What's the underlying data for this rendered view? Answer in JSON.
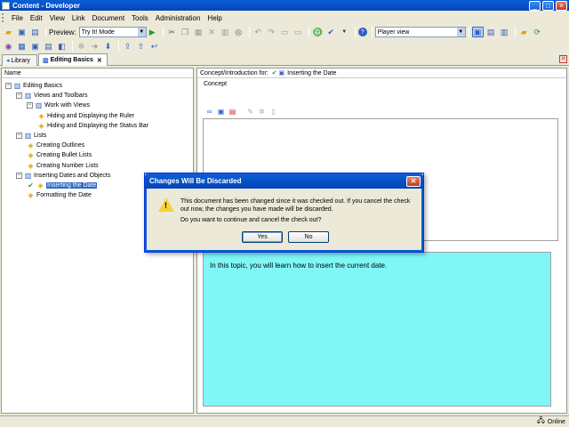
{
  "window": {
    "title": "Content - Developer"
  },
  "menu": [
    "File",
    "Edit",
    "View",
    "Link",
    "Document",
    "Tools",
    "Administration",
    "Help"
  ],
  "toolbar": {
    "preview_label": "Preview:",
    "preview_mode": "Try It! Mode",
    "view_mode": "Player view"
  },
  "tabs": [
    {
      "label": "Library",
      "active": false
    },
    {
      "label": "Editing Basics",
      "active": true
    }
  ],
  "tree": {
    "header": "Name",
    "items": [
      {
        "label": "Editing Basics",
        "level": 0,
        "type": "book",
        "expanded": true
      },
      {
        "label": "Views and Toolbars",
        "level": 1,
        "type": "book",
        "expanded": true
      },
      {
        "label": "Work with Views",
        "level": 2,
        "type": "book",
        "expanded": true
      },
      {
        "label": "Hiding and Displaying the Ruler",
        "level": 3,
        "type": "topic"
      },
      {
        "label": "Hiding and Displaying the Status Bar",
        "level": 3,
        "type": "topic"
      },
      {
        "label": "Lists",
        "level": 1,
        "type": "book",
        "expanded": true
      },
      {
        "label": "Creating Outlines",
        "level": 2,
        "type": "topic"
      },
      {
        "label": "Creating Bullet Lists",
        "level": 2,
        "type": "topic"
      },
      {
        "label": "Creating Number Lists",
        "level": 2,
        "type": "topic"
      },
      {
        "label": "Inserting Dates and Objects",
        "level": 1,
        "type": "book",
        "expanded": true
      },
      {
        "label": "Inserting the Date",
        "level": 2,
        "type": "topic",
        "selected": true,
        "checked_out": true
      },
      {
        "label": "Formatting the Date",
        "level": 2,
        "type": "topic"
      }
    ]
  },
  "right": {
    "header_label": "Concept/Introduction for:",
    "header_topic": "Inserting the Date",
    "concept_label": "Concept",
    "intro_text": "In this topic, you will learn how to insert the current date.",
    "intro_color": "#80F7F7"
  },
  "status": {
    "text": "Online"
  },
  "dialog": {
    "title": "Changes Will Be Discarded",
    "message_1": "This document has been changed since it was checked out. If you cancel the check out now, the changes you have made will be discarded.",
    "message_2": "Do you want to continue and cancel the check out?",
    "yes_label": "Yes",
    "no_label": "No",
    "icon": "warning-icon"
  }
}
